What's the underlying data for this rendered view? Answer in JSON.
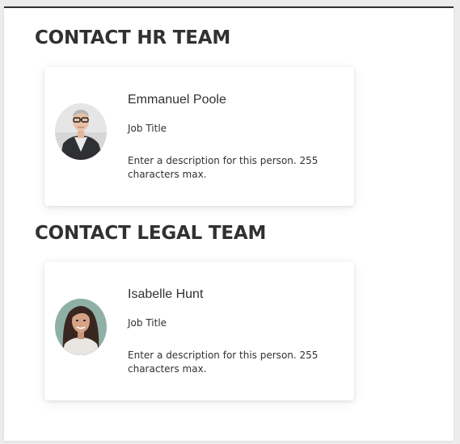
{
  "sections": [
    {
      "title": "CONTACT HR TEAM",
      "person": {
        "name": "Emmanuel Poole",
        "job_title": "Job Title",
        "description": "Enter a description for this person. 255 characters max."
      }
    },
    {
      "title": "CONTACT LEGAL TEAM",
      "person": {
        "name": "Isabelle Hunt",
        "job_title": "Job Title",
        "description": "Enter a description for this person. 255 characters max."
      }
    }
  ],
  "colors": {
    "text": "#323130",
    "card_bg": "#ffffff",
    "page_bg": "#ececec"
  }
}
